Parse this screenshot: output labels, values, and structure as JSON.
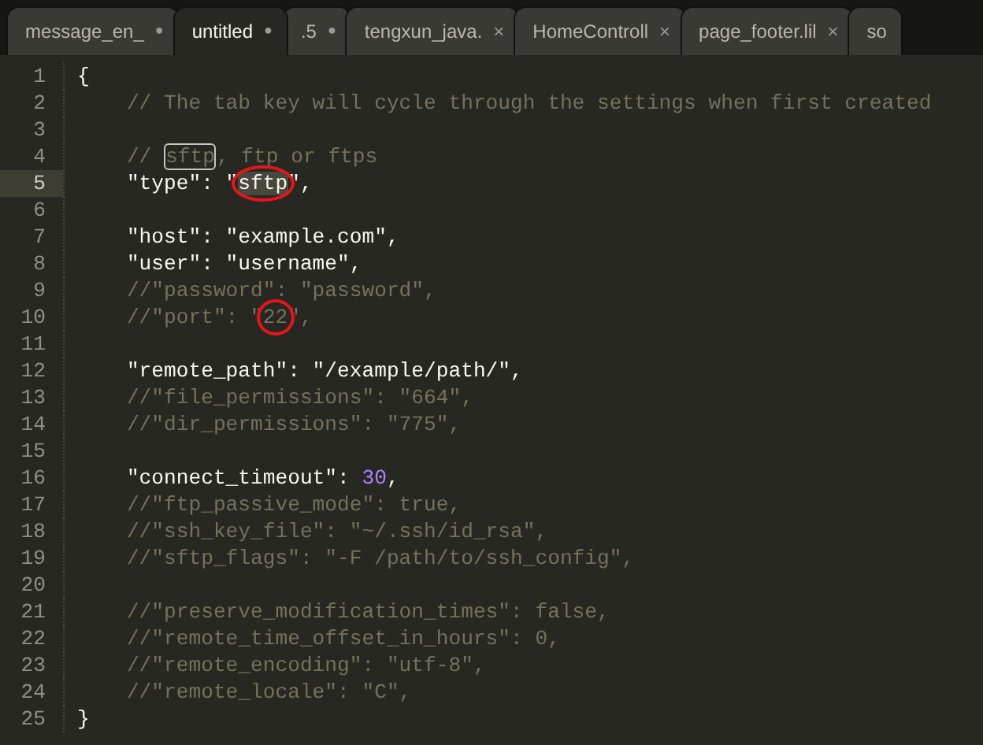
{
  "tabs": [
    {
      "label": "message_en_",
      "selected": false,
      "marker": "●",
      "kind": "dot"
    },
    {
      "label": "untitled",
      "selected": true,
      "marker": "●",
      "kind": "dot"
    },
    {
      "label": ".5",
      "selected": false,
      "marker": "●",
      "kind": "dot"
    },
    {
      "label": "tengxun_java.",
      "selected": false,
      "marker": "×",
      "kind": "close"
    },
    {
      "label": "HomeControll",
      "selected": false,
      "marker": "×",
      "kind": "close"
    },
    {
      "label": "page_footer.lil",
      "selected": false,
      "marker": "×",
      "kind": "close"
    },
    {
      "label": "so",
      "selected": false
    }
  ],
  "editor": {
    "lines": [
      {
        "number": "1",
        "current": false,
        "segments": [
          {
            "text": "{",
            "kind": "plain"
          }
        ]
      },
      {
        "number": "2",
        "current": false,
        "segments": [
          {
            "text": "    // The tab key will cycle through the settings when first created",
            "kind": "comment"
          }
        ]
      },
      {
        "number": "3",
        "current": false
      },
      {
        "number": "4",
        "current": false,
        "segments": [
          {
            "text": "    // ",
            "kind": "comment"
          },
          {
            "text": "sftp",
            "kind": "match"
          },
          {
            "text": ", ftp or ftps",
            "kind": "comment"
          }
        ]
      },
      {
        "number": "5",
        "current": true,
        "segments": [
          {
            "text": "    \"type\": \"",
            "kind": "plain"
          },
          {
            "text": "sftp",
            "kind": "selection",
            "circled": true
          },
          {
            "text": "\",",
            "kind": "plain"
          }
        ]
      },
      {
        "number": "6",
        "current": false
      },
      {
        "number": "7",
        "current": false,
        "segments": [
          {
            "text": "    \"host\": \"example.com\",",
            "kind": "plain"
          }
        ]
      },
      {
        "number": "8",
        "current": false,
        "segments": [
          {
            "text": "    \"user\": \"username\",",
            "kind": "plain"
          }
        ]
      },
      {
        "number": "9",
        "current": false,
        "segments": [
          {
            "text": "    //\"password\": \"password\",",
            "kind": "comment"
          }
        ]
      },
      {
        "number": "10",
        "current": false,
        "segments": [
          {
            "text": "    //\"port\": \"",
            "kind": "comment"
          },
          {
            "text": "22",
            "kind": "comment",
            "circled": true
          },
          {
            "text": "\",",
            "kind": "comment"
          }
        ]
      },
      {
        "number": "11",
        "current": false
      },
      {
        "number": "12",
        "current": false,
        "segments": [
          {
            "text": "    \"remote_path\": \"/example/path/\",",
            "kind": "plain"
          }
        ]
      },
      {
        "number": "13",
        "current": false,
        "segments": [
          {
            "text": "    //\"file_permissions\": \"664\",",
            "kind": "comment"
          }
        ]
      },
      {
        "number": "14",
        "current": false,
        "segments": [
          {
            "text": "    //\"dir_permissions\": \"775\",",
            "kind": "comment"
          }
        ]
      },
      {
        "number": "15",
        "current": false
      },
      {
        "number": "16",
        "current": false,
        "segments": [
          {
            "text": "    \"connect_timeout\": ",
            "kind": "plain"
          },
          {
            "text": "30",
            "kind": "number"
          },
          {
            "text": ",",
            "kind": "plain"
          }
        ]
      },
      {
        "number": "17",
        "current": false,
        "segments": [
          {
            "text": "    //\"ftp_passive_mode\": true,",
            "kind": "comment"
          }
        ]
      },
      {
        "number": "18",
        "current": false,
        "segments": [
          {
            "text": "    //\"ssh_key_file\": \"~/.ssh/id_rsa\",",
            "kind": "comment"
          }
        ]
      },
      {
        "number": "19",
        "current": false,
        "segments": [
          {
            "text": "    //\"sftp_flags\": \"-F /path/to/ssh_config\",",
            "kind": "comment"
          }
        ]
      },
      {
        "number": "20",
        "current": false
      },
      {
        "number": "21",
        "current": false,
        "segments": [
          {
            "text": "    //\"preserve_modification_times\": false,",
            "kind": "comment"
          }
        ]
      },
      {
        "number": "22",
        "current": false,
        "segments": [
          {
            "text": "    //\"remote_time_offset_in_hours\": 0,",
            "kind": "comment"
          }
        ]
      },
      {
        "number": "23",
        "current": false,
        "segments": [
          {
            "text": "    //\"remote_encoding\": \"utf-8\",",
            "kind": "comment"
          }
        ]
      },
      {
        "number": "24",
        "current": false,
        "segments": [
          {
            "text": "    //\"remote_locale\": \"C\",",
            "kind": "comment"
          }
        ]
      },
      {
        "number": "25",
        "current": false,
        "segments": [
          {
            "text": "}",
            "kind": "plain"
          }
        ]
      }
    ]
  }
}
